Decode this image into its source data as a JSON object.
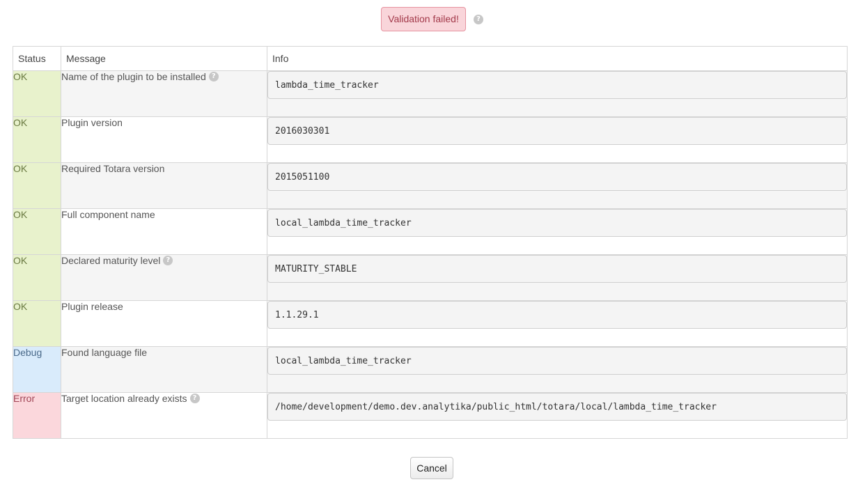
{
  "header": {
    "alert_text": "Validation failed!",
    "help_icon": "question-circle-icon"
  },
  "table": {
    "columns": [
      "Status",
      "Message",
      "Info"
    ],
    "rows": [
      {
        "status": "OK",
        "status_type": "ok",
        "message": "Name of the plugin to be installed",
        "has_help": true,
        "info": "lambda_time_tracker"
      },
      {
        "status": "OK",
        "status_type": "ok",
        "message": "Plugin version",
        "has_help": false,
        "info": "2016030301"
      },
      {
        "status": "OK",
        "status_type": "ok",
        "message": "Required Totara version",
        "has_help": false,
        "info": "2015051100"
      },
      {
        "status": "OK",
        "status_type": "ok",
        "message": "Full component name",
        "has_help": false,
        "info": "local_lambda_time_tracker"
      },
      {
        "status": "OK",
        "status_type": "ok",
        "message": "Declared maturity level",
        "has_help": true,
        "info": "MATURITY_STABLE"
      },
      {
        "status": "OK",
        "status_type": "ok",
        "message": "Plugin release",
        "has_help": false,
        "info": "1.1.29.1"
      },
      {
        "status": "Debug",
        "status_type": "debug",
        "message": "Found language file",
        "has_help": false,
        "info": "local_lambda_time_tracker"
      },
      {
        "status": "Error",
        "status_type": "error",
        "message": "Target location already exists",
        "has_help": true,
        "info": "/home/development/demo.dev.analytika/public_html/totara/local/lambda_time_tracker"
      }
    ]
  },
  "footer": {
    "cancel_label": "Cancel"
  },
  "colors": {
    "ok_bg": "#e8f2cc",
    "debug_bg": "#d9ebfb",
    "error_bg": "#fbd7dc",
    "alert_bg": "#f9d5da"
  }
}
